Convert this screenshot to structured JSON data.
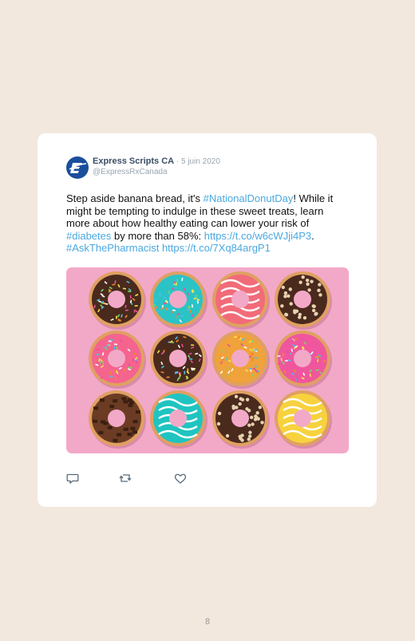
{
  "post": {
    "author_name": "Express Scripts CA",
    "separator": " · ",
    "date": "5 juin 2020",
    "handle": "@ExpressRxCanada",
    "text_1": "Step aside banana bread, it's ",
    "tag_1": "#NationalDonutDay",
    "text_2": "! While it might be tempting to indulge in these sweet treats, learn more about how healthy eating can lower your risk of ",
    "tag_2": "#diabetes",
    "text_3": " by more than 58%: ",
    "link_1": "https://t.co/w6cWJji4P3",
    "text_4": ". ",
    "tag_3": "#AskThePharmacist",
    "text_5": " ",
    "link_2": "https://t.co/7Xq84argP1",
    "image_icon": "donuts-photo",
    "actions": [
      "reply-icon",
      "retweet-icon",
      "like-icon"
    ]
  },
  "page_number": "8",
  "colors": {
    "background": "#f3e8de",
    "card": "#ffffff",
    "link": "#4aa8e0",
    "author": "#3a4d66",
    "photo_background": "#f2a9c8"
  }
}
